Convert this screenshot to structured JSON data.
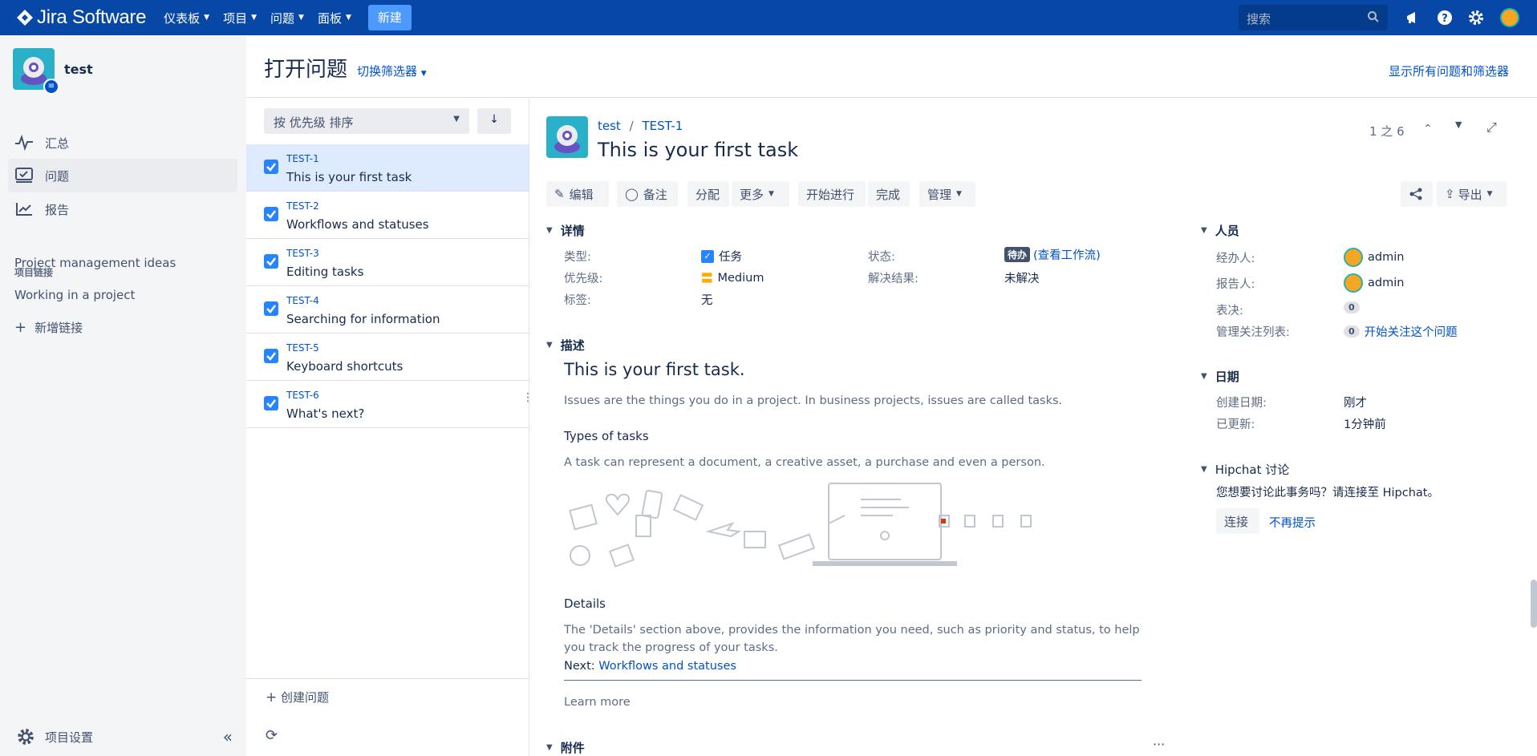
{
  "topbar": {
    "app_name": "Jira Software",
    "nav": [
      "仪表板",
      "项目",
      "问题",
      "面板"
    ],
    "create_label": "新建",
    "search_placeholder": "搜索"
  },
  "sidebar": {
    "project_name": "test",
    "items": [
      {
        "label": "汇总",
        "icon": "pulse-icon"
      },
      {
        "label": "问题",
        "icon": "issues-icon"
      },
      {
        "label": "报告",
        "icon": "chart-icon"
      }
    ],
    "links_heading": "项目链接",
    "links": [
      "Project management ideas",
      "Working in a project"
    ],
    "add_link_label": "新增链接",
    "settings_label": "项目设置"
  },
  "header": {
    "title": "打开问题",
    "switch_filter": "切换筛选器",
    "show_all": "显示所有问题和筛选器"
  },
  "list": {
    "sort_label": "按 优先级 排序",
    "issues": [
      {
        "key": "TEST-1",
        "summary": "This is your first task"
      },
      {
        "key": "TEST-2",
        "summary": "Workflows and statuses"
      },
      {
        "key": "TEST-3",
        "summary": "Editing tasks"
      },
      {
        "key": "TEST-4",
        "summary": "Searching for information"
      },
      {
        "key": "TEST-5",
        "summary": "Keyboard shortcuts"
      },
      {
        "key": "TEST-6",
        "summary": "What's next?"
      }
    ],
    "create_issue": "创建问题"
  },
  "detail": {
    "breadcrumb_project": "test",
    "breadcrumb_key": "TEST-1",
    "title": "This is your first task",
    "pager": "1 之 6",
    "actions": {
      "edit": "编辑",
      "comment": "备注",
      "assign": "分配",
      "more": "更多",
      "start": "开始进行",
      "done": "完成",
      "admin": "管理",
      "export": "导出"
    },
    "details": {
      "heading": "详情",
      "type_label": "类型:",
      "type_value": "任务",
      "priority_label": "优先级:",
      "priority_value": "Medium",
      "labels_label": "标签:",
      "labels_value": "无",
      "status_label": "状态:",
      "status_value": "待办",
      "view_workflow": "(查看工作流)",
      "resolution_label": "解决结果:",
      "resolution_value": "未解决"
    },
    "description": {
      "heading": "描述",
      "h1": "This is your first task.",
      "p1": "Issues are the things you do in a project. In business projects, issues are called tasks.",
      "types_heading": "Types of tasks",
      "p2": "A task can represent a document, a creative asset, a purchase and even a person.",
      "details_heading": "Details",
      "p3": "The 'Details' section above, provides the information you need, such as priority and status, to help you track the progress of your tasks.",
      "next_label": "Next:",
      "next_link": "Workflows and statuses",
      "learn_more": "Learn more"
    },
    "attachments_heading": "附件",
    "people": {
      "heading": "人员",
      "assignee_label": "经办人:",
      "assignee": "admin",
      "reporter_label": "报告人:",
      "reporter": "admin",
      "votes_label": "表决:",
      "votes": "0",
      "watchers_label": "管理关注列表:",
      "watchers": "0",
      "watch_link": "开始关注这个问题"
    },
    "dates": {
      "heading": "日期",
      "created_label": "创建日期:",
      "created": "刚才",
      "updated_label": "已更新:",
      "updated": "1分钟前"
    },
    "hipchat": {
      "heading": "Hipchat 讨论",
      "text": "您想要讨论此事务吗？请连接至 Hipchat。",
      "connect": "连接",
      "dismiss": "不再提示"
    }
  },
  "colors": {
    "topbar": "#0747a6",
    "link": "#0052cc",
    "checkbox": "#2684ff"
  }
}
